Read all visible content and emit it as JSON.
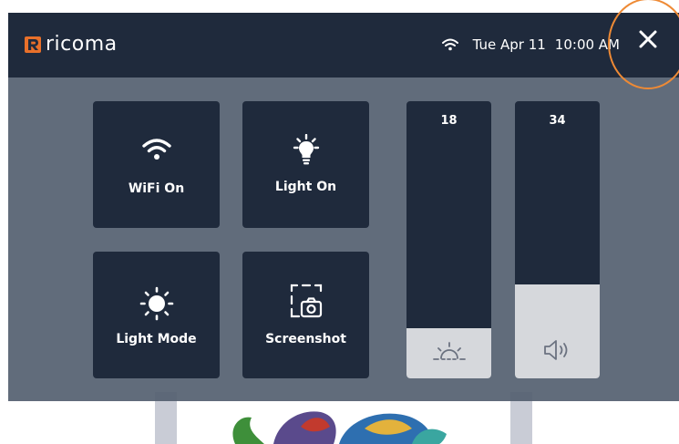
{
  "header": {
    "brand": "ricoma",
    "date": "Tue Apr 11",
    "time": "10:00 AM",
    "close_icon": "close-icon",
    "wifi_icon": "wifi-icon"
  },
  "tiles": [
    {
      "label": "WiFi On",
      "icon": "wifi-icon"
    },
    {
      "label": "Light On",
      "icon": "lightbulb-icon"
    },
    {
      "label": "Light Mode",
      "icon": "sun-icon"
    },
    {
      "label": "Screenshot",
      "icon": "screenshot-icon"
    }
  ],
  "sliders": [
    {
      "name": "brightness",
      "value": "18",
      "level": 0.18,
      "icon": "brightness-icon"
    },
    {
      "name": "volume",
      "value": "34",
      "level": 0.34,
      "icon": "speaker-icon"
    }
  ],
  "colors": {
    "panel_dark": "#1f2a3c",
    "overlay": "#546070",
    "slider_fill": "#d6d8dc",
    "brand_orange": "#e8702a",
    "highlight_ring": "#ee8a35"
  }
}
